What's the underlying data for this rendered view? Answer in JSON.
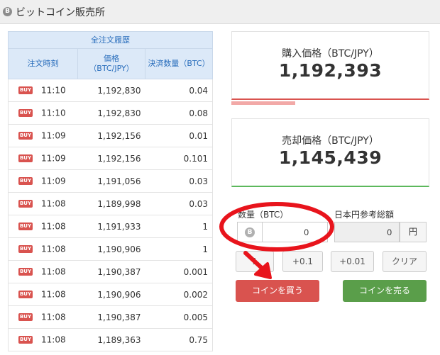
{
  "header": {
    "coin_icon": "bitcoin-icon",
    "title": "ビットコイン販売所"
  },
  "history": {
    "caption": "全注文履歴",
    "columns": [
      "注文時刻",
      "価格\n（BTC/JPY）",
      "決済数量（BTC）"
    ],
    "rows": [
      {
        "side": "BUY",
        "time": "11:10",
        "price": "1,192,830",
        "amount": "0.04"
      },
      {
        "side": "BUY",
        "time": "11:10",
        "price": "1,192,830",
        "amount": "0.08"
      },
      {
        "side": "BUY",
        "time": "11:09",
        "price": "1,192,156",
        "amount": "0.01"
      },
      {
        "side": "BUY",
        "time": "11:09",
        "price": "1,192,156",
        "amount": "0.101"
      },
      {
        "side": "BUY",
        "time": "11:09",
        "price": "1,191,056",
        "amount": "0.03"
      },
      {
        "side": "BUY",
        "time": "11:08",
        "price": "1,189,998",
        "amount": "0.03"
      },
      {
        "side": "BUY",
        "time": "11:08",
        "price": "1,191,933",
        "amount": "1"
      },
      {
        "side": "BUY",
        "time": "11:08",
        "price": "1,190,906",
        "amount": "1"
      },
      {
        "side": "BUY",
        "time": "11:08",
        "price": "1,190,387",
        "amount": "0.001"
      },
      {
        "side": "BUY",
        "time": "11:08",
        "price": "1,190,906",
        "amount": "0.002"
      },
      {
        "side": "BUY",
        "time": "11:08",
        "price": "1,190,387",
        "amount": "0.005"
      },
      {
        "side": "BUY",
        "time": "11:08",
        "price": "1,189,363",
        "amount": "0.75"
      }
    ]
  },
  "buy_price": {
    "label": "購入価格（BTC/JPY）",
    "value": "1,192,393"
  },
  "sell_price": {
    "label": "売却価格（BTC/JPY）",
    "value": "1,145,439"
  },
  "form": {
    "qty_label": "数量（BTC）",
    "qty_value": "0",
    "jpy_label": "日本円参考総額",
    "jpy_value": "0",
    "jpy_unit": "円",
    "step_buttons": [
      "1",
      "+0.1",
      "+0.01",
      "クリア"
    ],
    "buy_button": "コインを買う",
    "sell_button": "コインを売る"
  },
  "colors": {
    "buy": "#d9534f",
    "sell": "#5a9e4a",
    "header_blue": "#2a6ebc",
    "annotation": "#e8141c"
  }
}
